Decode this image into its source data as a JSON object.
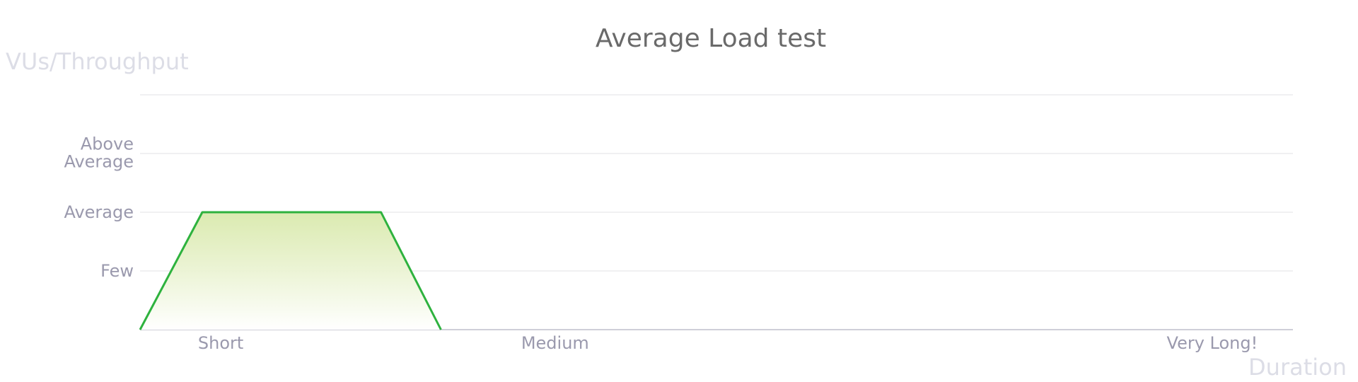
{
  "colors": {
    "line": "#2eb23e",
    "fill_top": "#d7e8a8",
    "fill_bottom": "#ffffff",
    "grid": "#f0f0f2",
    "baseline": "#cfcfd8"
  },
  "chart_data": {
    "type": "area",
    "title": "Average Load test",
    "ylabel": "VUs/Throughput",
    "xlabel": "Duration",
    "x_ticks": [
      {
        "label": "Short",
        "x": 0.07
      },
      {
        "label": "Medium",
        "x": 0.36
      },
      {
        "label": "Very Long!",
        "x": 0.93
      }
    ],
    "y_ticks": [
      {
        "lines": [
          "Few"
        ],
        "y": 1
      },
      {
        "lines": [
          "Average"
        ],
        "y": 2
      },
      {
        "lines": [
          "Above",
          "Average"
        ],
        "y": 3
      }
    ],
    "xlim": [
      0,
      1
    ],
    "ylim": [
      0,
      4
    ],
    "grid": true,
    "series": [
      {
        "points": [
          [
            0,
            0
          ],
          [
            0.054,
            2
          ],
          [
            0.209,
            2
          ],
          [
            0.261,
            0
          ]
        ]
      }
    ]
  }
}
